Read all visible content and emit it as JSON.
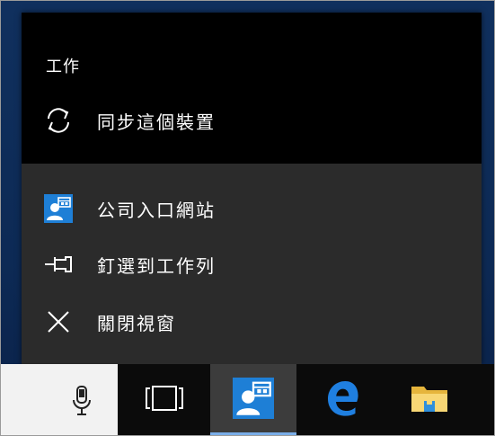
{
  "jumplist": {
    "section_title": "工作",
    "tasks": [
      {
        "label": "同步這個裝置",
        "icon": "sync-icon"
      }
    ],
    "items": [
      {
        "label": "公司入口網站",
        "icon": "company-portal-icon"
      },
      {
        "label": "釘選到工作列",
        "icon": "pin-icon"
      },
      {
        "label": "關閉視窗",
        "icon": "close-icon"
      }
    ]
  },
  "taskbar": {
    "buttons": [
      {
        "name": "cortana-microphone",
        "icon": "microphone-icon"
      },
      {
        "name": "task-view",
        "icon": "task-view-icon"
      },
      {
        "name": "company-portal",
        "icon": "company-portal-icon",
        "active": true
      },
      {
        "name": "edge",
        "icon": "edge-icon"
      },
      {
        "name": "file-explorer",
        "icon": "folder-icon"
      }
    ]
  },
  "colors": {
    "desktop": "#10305e",
    "jumplist_top": "#000000",
    "jumplist_body": "#2b2b2b",
    "taskbar": "#0b0b0b",
    "cortana_box": "#f2f2f2",
    "accent": "#0078d7",
    "active_indicator": "#7aaee8"
  }
}
